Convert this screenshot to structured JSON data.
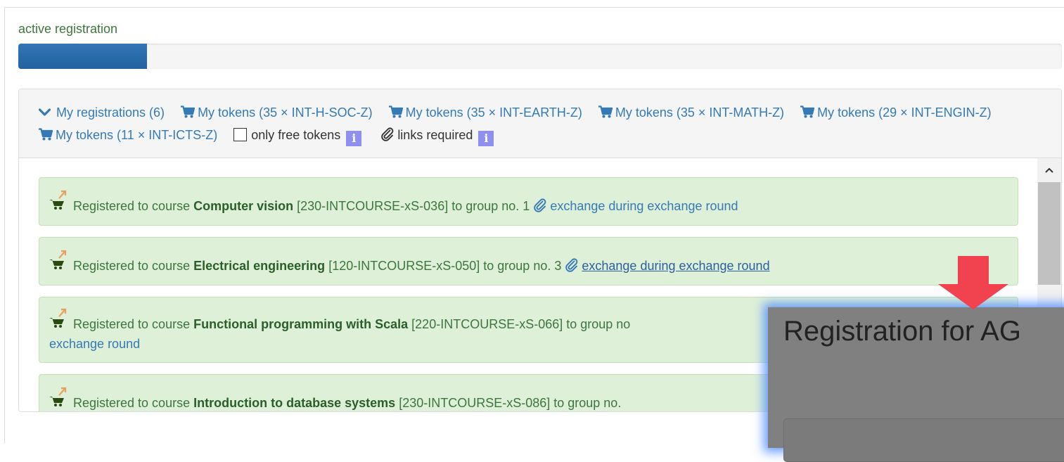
{
  "section": {
    "title": "active registration",
    "progress_fraction": 0.123
  },
  "header": {
    "my_registrations": "My registrations (6)",
    "tokens": [
      "My tokens (35 × INT-H-SOC-Z)",
      "My tokens (35 × INT-EARTH-Z)",
      "My tokens (35 × INT-MATH-Z)",
      "My tokens (29 × INT-ENGIN-Z)",
      "My tokens (11 × INT-ICTS-Z)"
    ],
    "only_free_tokens": "only free tokens",
    "links_required": "links required",
    "info_glyph": "i"
  },
  "registrations": [
    {
      "prefix": "Registered to course",
      "course": "Computer vision",
      "code": "[230-INTCOURSE-xS-036] to group no. 1",
      "link": "exchange during exchange round"
    },
    {
      "prefix": "Registered to course",
      "course": "Electrical engineering",
      "code": "[120-INTCOURSE-xS-050] to group no. 3",
      "link": "exchange during exchange round"
    },
    {
      "prefix": "Registered to course",
      "course": "Functional programming with Scala",
      "code": "[220-INTCOURSE-xS-066] to group no",
      "link": "exchange round"
    },
    {
      "prefix": "Registered to course",
      "course": "Introduction to database systems",
      "code": "[230-INTCOURSE-xS-086] to group no."
    }
  ],
  "overlay": {
    "title": "Registration for AG"
  },
  "colors": {
    "accent": "#337ab7",
    "progress": "#2a6aa8",
    "success_bg": "#dff0d8",
    "success_text": "#3c763d",
    "arrow": "#f0424f",
    "overlay": "#808080",
    "info": "#8f8ff0"
  }
}
